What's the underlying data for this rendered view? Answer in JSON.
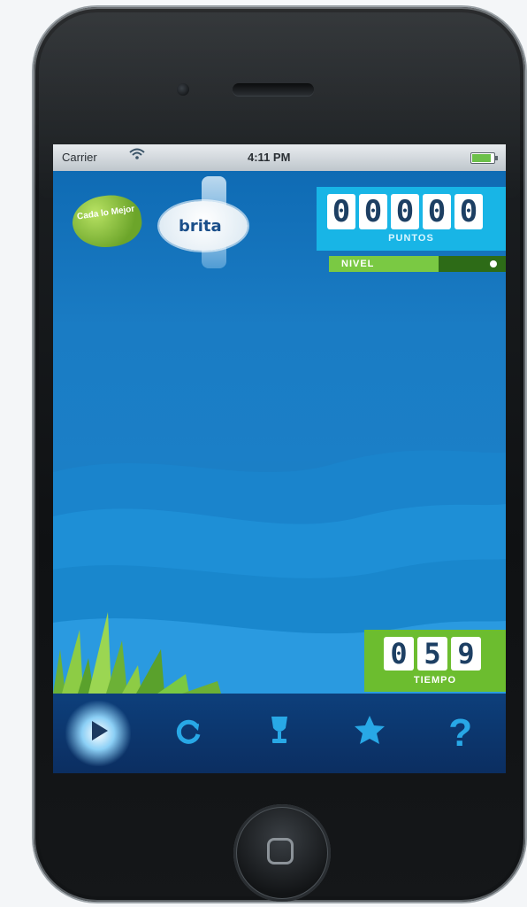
{
  "status_bar": {
    "carrier": "Carrier",
    "wifi_icon": "wifi-icon",
    "time": "4:11 PM",
    "battery_level": 0.9
  },
  "logo": {
    "leaf_text": "Cada lo Mejor",
    "brand": "brita"
  },
  "score": {
    "digits": [
      "0",
      "0",
      "0",
      "0",
      "0"
    ],
    "label": "PUNTOS"
  },
  "progress": {
    "label": "NIVEL",
    "value": 0.62
  },
  "timer": {
    "digits": [
      "0",
      "5",
      "9"
    ],
    "label": "TIEMPO"
  },
  "tab_bar": {
    "items": [
      {
        "icon": "play-icon",
        "active": true
      },
      {
        "icon": "refresh-icon",
        "active": false
      },
      {
        "icon": "trophy-icon",
        "active": false
      },
      {
        "icon": "star-icon",
        "active": false
      },
      {
        "icon": "help-icon",
        "active": false
      }
    ]
  },
  "colors": {
    "sky_top": "#0f6bb4",
    "water": "#1b82c6",
    "score_panel": "#18b5e6",
    "timer_panel": "#6cbd2f",
    "progress_fill": "#7ac943",
    "tab_bar": "#0b2e61"
  }
}
